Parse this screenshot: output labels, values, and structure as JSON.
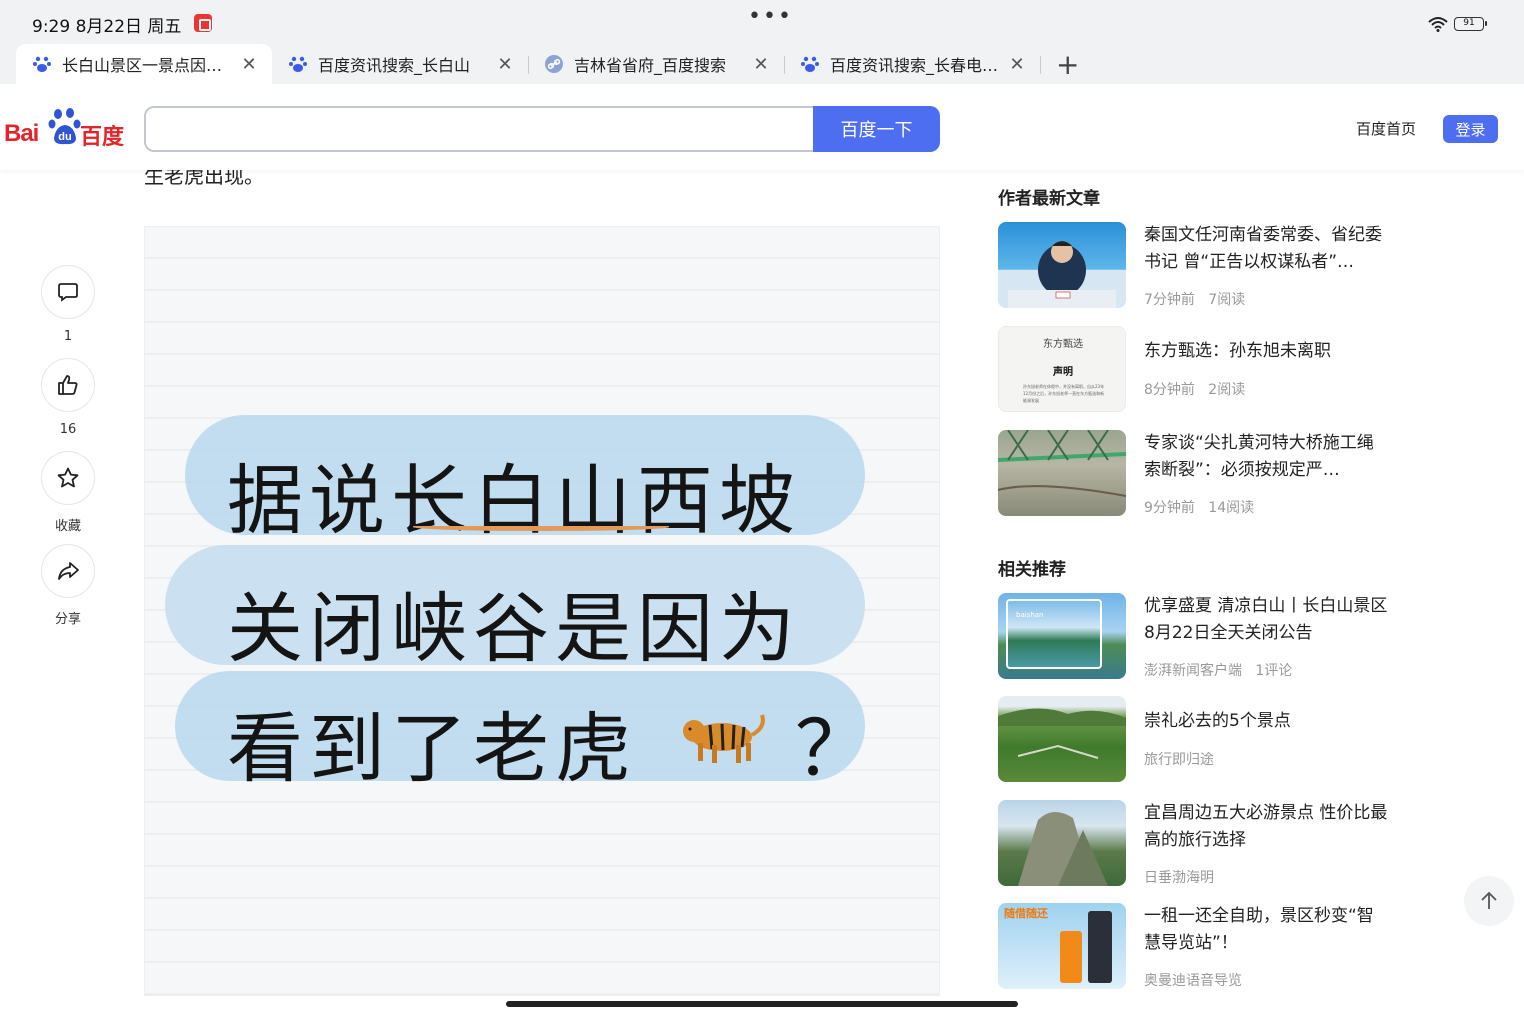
{
  "status_bar": {
    "time": "9:29  8月22日 周五",
    "battery": "91"
  },
  "tabs": [
    {
      "title": "长白山景区一景点因…",
      "icon": "baidu-paw-icon"
    },
    {
      "title": "百度资讯搜索_长白山",
      "icon": "baidu-paw-icon"
    },
    {
      "title": "吉林省省府_百度搜索",
      "icon": "link-icon"
    },
    {
      "title": "百度资讯搜索_长春电…",
      "icon": "baidu-paw-icon"
    }
  ],
  "header": {
    "logo_left": "Bai",
    "logo_right": "百度",
    "search_placeholder": "",
    "search_button": "百度一下",
    "home_link": "百度首页",
    "login_button": "登录"
  },
  "article": {
    "text_fragment": "生老虎出现。",
    "image_lines": [
      "据说长白山西坡",
      "关闭峡谷是因为",
      "看到了老虎",
      "？"
    ]
  },
  "actions": {
    "comment_count": "1",
    "like_count": "16",
    "favorite_label": "收藏",
    "share_label": "分享"
  },
  "author_section": {
    "title": "作者最新文章",
    "items": [
      {
        "title": "秦国文任河南省委常委、省纪委书记 曾“正告以权谋私者”…",
        "time": "7分钟前",
        "reads": "7阅读"
      },
      {
        "title": "东方甄选：孙东旭未离职",
        "time": "8分钟前",
        "reads": "2阅读"
      },
      {
        "title": "专家谈“尖扎黄河特大桥施工绳索断裂”：必须按规定严…",
        "time": "9分钟前",
        "reads": "14阅读"
      }
    ]
  },
  "thumb2": {
    "brand": "东方甄选",
    "heading": "声明",
    "body": "孙东旭老师在休假中，并没有离职。自从23年12月份之后，孙东旭老师一直在东方甄选和新能源发展"
  },
  "related_section": {
    "title": "相关推荐",
    "items": [
      {
        "title": "优享盛夏 清凉白山丨长白山景区8月22日全天关闭公告",
        "source": "澎湃新闻客户端",
        "extra": "1评论",
        "thumb_text": "baishan"
      },
      {
        "title": "崇礼必去的5个景点",
        "source": "旅行即归途",
        "extra": ""
      },
      {
        "title": "宜昌周边五大必游景点 性价比最高的旅行选择",
        "source": "日垂渤海明",
        "extra": ""
      },
      {
        "title": "一租一还全自助，景区秒变“智慧导览站”！",
        "source": "奥曼迪语音导览",
        "extra": "",
        "thumb_text": "随借随还"
      }
    ]
  }
}
